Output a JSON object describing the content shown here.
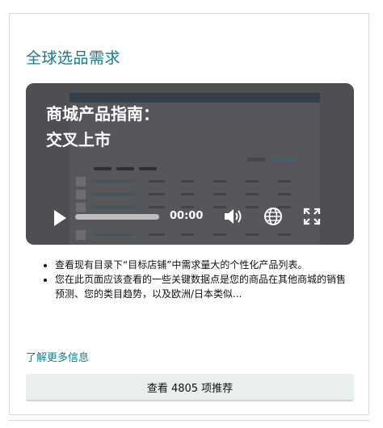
{
  "card": {
    "title": "全球选品需求",
    "video": {
      "title_lines": [
        "商城产品指南：",
        "交叉上市"
      ],
      "time": "00:00",
      "progress": 0
    },
    "bullets": [
      "查看现有目录下“目标店铺”中需求量大的个性化产品列表。",
      "您在此页面应该查看的一些关键数据点是您的商品在其他商城的销售预测、您的类目趋势，以及欧洲/日本类似..."
    ],
    "learn_more": "了解更多信息",
    "cta_label": "查看 4805 项推荐"
  },
  "colors": {
    "accent": "#147c8f",
    "card_border": "#d5d9d9",
    "button_bg": "#e9eeee"
  }
}
